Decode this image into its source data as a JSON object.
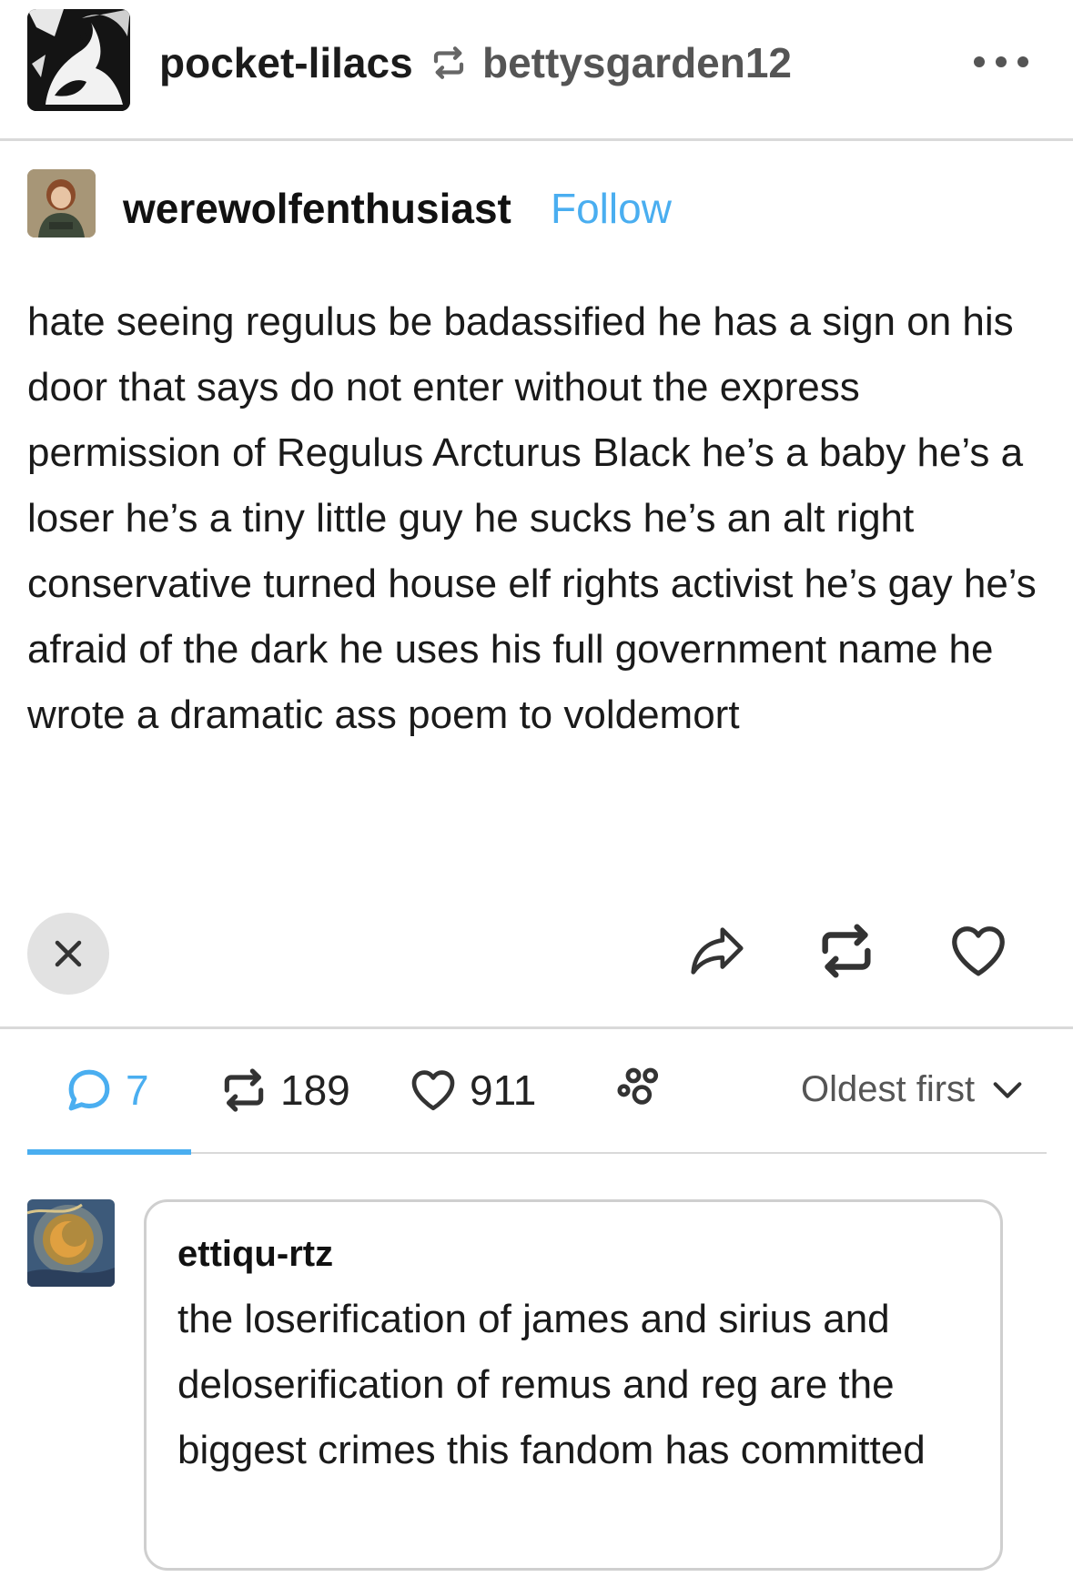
{
  "header": {
    "reblogger": "pocket-lilacs",
    "source": "bettysgarden12",
    "icons": {
      "reblog": "reblog-icon",
      "more": "more-horizontal-icon"
    }
  },
  "post": {
    "author": "werewolfenthusiast",
    "follow_label": "Follow",
    "body": "hate seeing regulus be badassified he has a sign on his door that says do not enter without the express permission of Regulus Arcturus Black he’s a baby he’s a loser he’s a tiny little guy he sucks he’s an alt right conservative turned house elf rights activist he’s gay he’s afraid of the dark he uses his full government name he wrote a dramatic ass poem to voldemort"
  },
  "actions": {
    "icons": [
      "close-icon",
      "share-icon",
      "reblog-icon",
      "heart-icon"
    ]
  },
  "notes": {
    "replies": "7",
    "reblogs": "189",
    "likes": "911",
    "sort_label": "Oldest first"
  },
  "colors": {
    "accent": "#4aaef0",
    "divider": "#d9d9d9",
    "close_bg": "#e2e2e2"
  },
  "comment": {
    "author": "ettiqu-rtz",
    "text": "the loserification of james and sirius and deloserification of remus and reg are the biggest crimes this fandom has committed"
  }
}
